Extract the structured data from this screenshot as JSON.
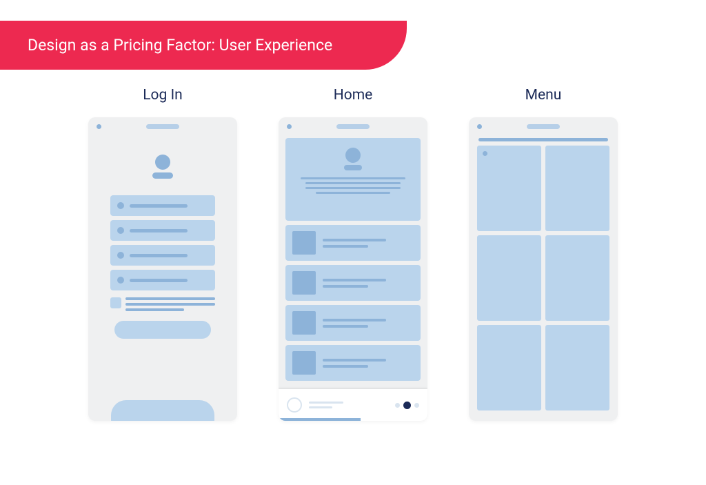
{
  "banner": {
    "title": "Design as a Pricing Factor: User Experience"
  },
  "mockups": {
    "login": {
      "label": "Log In"
    },
    "home": {
      "label": "Home"
    },
    "menu": {
      "label": "Menu"
    }
  }
}
